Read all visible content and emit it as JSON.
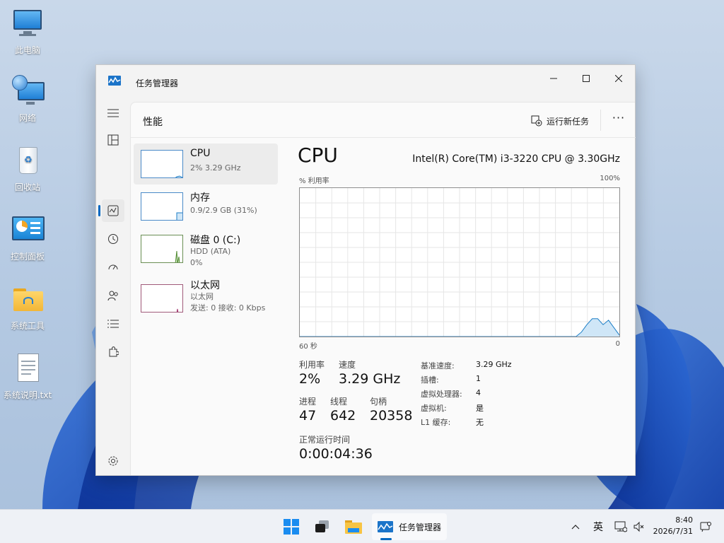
{
  "desktop": {
    "icons": [
      {
        "label": "此电脑",
        "icon": "computer-icon"
      },
      {
        "label": "网络",
        "icon": "network-icon"
      },
      {
        "label": "回收站",
        "icon": "recycle-bin-icon"
      },
      {
        "label": "控制面板",
        "icon": "control-panel-icon"
      },
      {
        "label": "系统工具",
        "icon": "folder-icon"
      },
      {
        "label": "系统说明.txt",
        "icon": "text-file-icon"
      }
    ]
  },
  "window": {
    "title": "任务管理器",
    "page_title": "性能",
    "run_new_task": "运行新任务",
    "more": "···"
  },
  "perf_list": [
    {
      "name": "CPU",
      "sub1": "2% 3.29 GHz",
      "sub2": ""
    },
    {
      "name": "内存",
      "sub1": "0.9/2.9 GB (31%)",
      "sub2": ""
    },
    {
      "name": "磁盘 0 (C:)",
      "sub1": "HDD (ATA)",
      "sub2": "0%"
    },
    {
      "name": "以太网",
      "sub1": "以太网",
      "sub2": "发送: 0 接收: 0 Kbps"
    }
  ],
  "cpu": {
    "heading": "CPU",
    "model": "Intel(R) Core(TM) i3-3220 CPU @ 3.30GHz",
    "graph_ylabel": "% 利用率",
    "graph_ymax": "100%",
    "graph_xleft": "60 秒",
    "graph_xright": "0",
    "usage_history": [
      0,
      0,
      0,
      0,
      0,
      0,
      0,
      0,
      0,
      0,
      0,
      0,
      0,
      0,
      0,
      0,
      0,
      0,
      0,
      0,
      0,
      0,
      0,
      0,
      0,
      0,
      0,
      0,
      0,
      0,
      0,
      0,
      0,
      0,
      0,
      0,
      0,
      0,
      0,
      0,
      0,
      0,
      0,
      0,
      0,
      0,
      0,
      0,
      0,
      0,
      0,
      0,
      3,
      8,
      12,
      12,
      8,
      11,
      6,
      1
    ],
    "stats": {
      "util_label": "利用率",
      "util_value": "2%",
      "speed_label": "速度",
      "speed_value": "3.29 GHz",
      "proc_label": "进程",
      "proc_value": "47",
      "thread_label": "线程",
      "thread_value": "642",
      "handle_label": "句柄",
      "handle_value": "20358",
      "uptime_label": "正常运行时间",
      "uptime_value": "0:00:04:36"
    },
    "details": [
      {
        "k": "基准速度:",
        "v": "3.29 GHz"
      },
      {
        "k": "插槽:",
        "v": "1"
      },
      {
        "k": "虚拟处理器:",
        "v": "4"
      },
      {
        "k": "虚拟机:",
        "v": "是"
      },
      {
        "k": "L1 缓存:",
        "v": "无"
      }
    ]
  },
  "taskbar": {
    "task_label": "任务管理器",
    "ime": "英",
    "time": "8:40",
    "date": "2026/7/31"
  },
  "colors": {
    "accent": "#0067c0",
    "graph_line": "#1d7fc7",
    "graph_fill": "#cfe6f7"
  }
}
